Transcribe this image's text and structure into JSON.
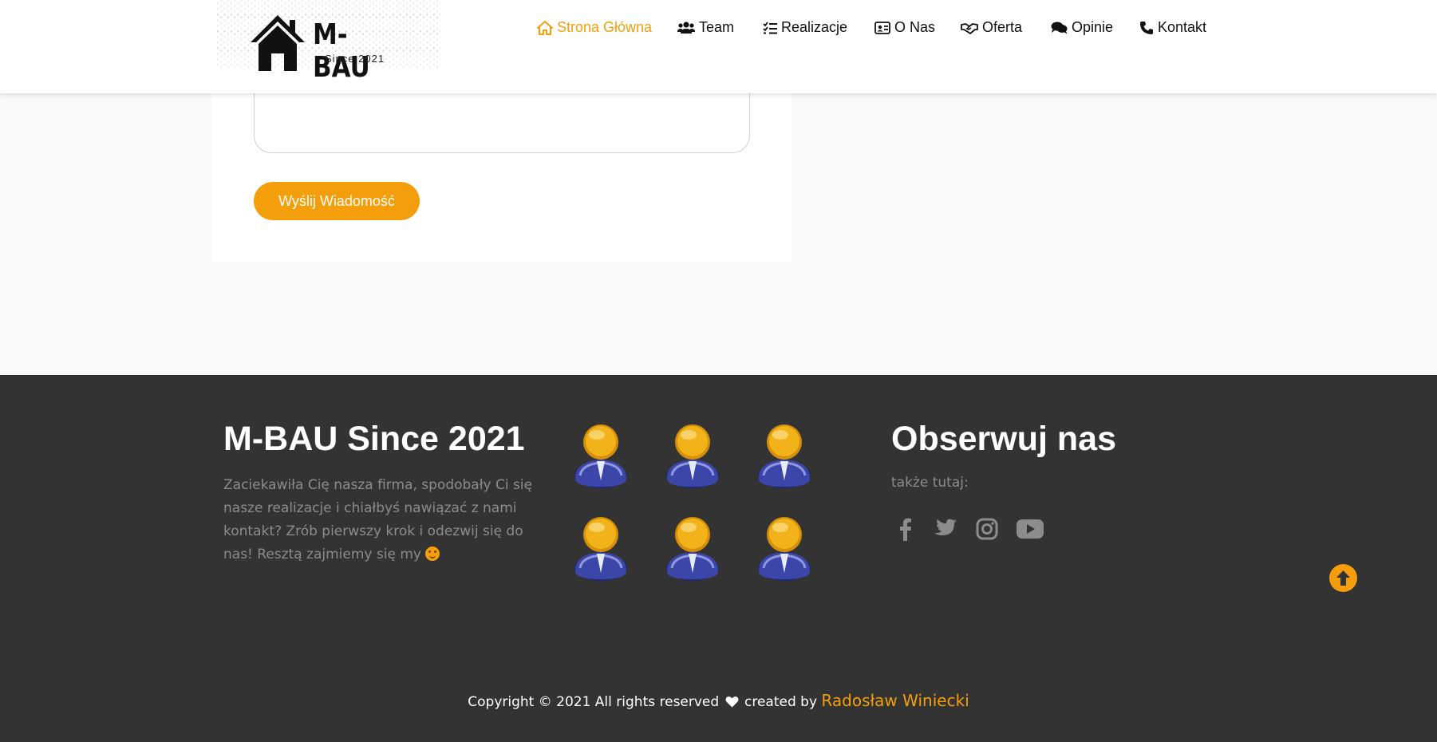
{
  "header": {
    "logo_title": "M-BAU",
    "logo_subtitle": "Since 2021",
    "nav": [
      {
        "label": "Strona Główna",
        "icon": "home-icon",
        "active": true
      },
      {
        "label": "Team",
        "icon": "users-icon",
        "active": false
      },
      {
        "label": "Realizacje",
        "icon": "list-check-icon",
        "active": false
      },
      {
        "label": "O Nas",
        "icon": "id-card-icon",
        "active": false
      },
      {
        "label": "Oferta",
        "icon": "handshake-icon",
        "active": false
      },
      {
        "label": "Opinie",
        "icon": "comments-icon",
        "active": false
      },
      {
        "label": "Kontakt",
        "icon": "phone-icon",
        "active": false
      }
    ]
  },
  "form": {
    "send_label": "Wyślij Wiadomość"
  },
  "footer": {
    "title": "M-BAU Since 2021",
    "text": "Zaciekawiła Cię nasza firma, spodobały Ci się nasze realizacje i chiałbyś nawiązać z nami kontakt? Zrób pierwszy krok i odezwij się do nas! Resztą zajmiemy się my",
    "follow_title": "Obserwuj nas",
    "follow_subtitle": "także tutaj:",
    "social": [
      "facebook-icon",
      "twitter-icon",
      "instagram-icon",
      "youtube-icon"
    ],
    "copyright_text": "Copyright © 2021 All rights reserved",
    "created_by": "created by",
    "author": "Radosław Winiecki"
  },
  "colors": {
    "accent": "#f59e0b",
    "footer_bg": "#333333",
    "page_bg": "#f8f9fa",
    "person_suit": "#3b46a8",
    "person_head": "#f2b31a"
  }
}
